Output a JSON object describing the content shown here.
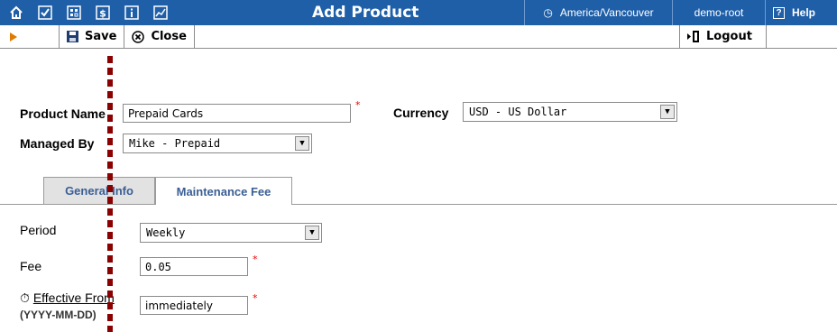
{
  "topbar": {
    "title": "Add Product",
    "timezone": "America/Vancouver",
    "user": "demo-root",
    "help": "Help",
    "icons": [
      "home-icon",
      "checkbox-icon",
      "grid-icon",
      "dollar-icon",
      "info-icon",
      "chart-icon"
    ]
  },
  "toolbar": {
    "save_label": "Save",
    "close_label": "Close",
    "logout_label": "Logout"
  },
  "form": {
    "product_name_label": "Product Name",
    "product_name_value": "Prepaid Cards",
    "currency_label": "Currency",
    "currency_value": "USD - US Dollar",
    "managed_by_label": "Managed By",
    "managed_by_value": "Mike - Prepaid"
  },
  "tabs": [
    {
      "label": "General Info",
      "active": false
    },
    {
      "label": "Maintenance Fee",
      "active": true
    }
  ],
  "maintenance": {
    "period_label": "Period",
    "period_value": "Weekly",
    "fee_label": "Fee",
    "fee_value": "0.05",
    "effective_label": "Effective From",
    "effective_format": "(YYYY-MM-DD)",
    "effective_value": "immediately"
  },
  "colors": {
    "topbar_bg": "#1f5fa8",
    "tab_text": "#3a5e95",
    "required_marker": "#e00000",
    "dotted_marker": "#8b0000"
  }
}
